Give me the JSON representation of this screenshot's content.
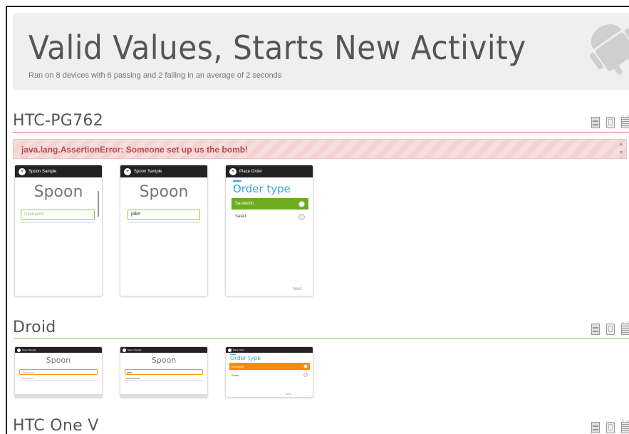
{
  "test": {
    "title": "Valid Values, Starts New Activity",
    "subtitle": "Ran on 8 devices with 6 passing and 2 failing in an average of 2 seconds"
  },
  "colors": {
    "fail_rule": "#e08080",
    "pass_rule": "#88cc66",
    "error_text": "#b94a48",
    "sandwich_green": "#6cac1e",
    "sandwich_orange": "#ff8a00",
    "order_blue": "#33a9d6"
  },
  "device_actions": {
    "icons": [
      "film-icon",
      "phone-icon",
      "log-icon"
    ]
  },
  "devices": [
    {
      "name": "HTC-PG762",
      "status": "failing",
      "error": "java.lang.AssertionError: Someone set up us the bomb!",
      "screens": [
        {
          "app_title": "Spoon Sample",
          "heading": "Spoon",
          "field_placeholder": "Username",
          "field_value": ""
        },
        {
          "app_title": "Spoon Sample",
          "heading": "Spoon",
          "field_placeholder": "",
          "field_value": "jake"
        },
        {
          "app_title": "Place Order",
          "heading": "Order type",
          "options": [
            "Sandwich",
            "Salad"
          ],
          "next": "Next"
        }
      ]
    },
    {
      "name": "Droid",
      "status": "passing",
      "screens": [
        {
          "app_title": "Spoon Sample",
          "heading": "Spoon",
          "field_placeholder": "Username",
          "password_placeholder": "Password"
        },
        {
          "app_title": "Spoon Sample",
          "heading": "Spoon",
          "field_value": "jake",
          "password_value": "••••••••••••••"
        },
        {
          "app_title": "Place Order",
          "heading": "Order type",
          "options": [
            "Sandwich",
            "Salad"
          ],
          "next": "Next"
        }
      ]
    },
    {
      "name": "HTC One V",
      "status": "unknown"
    }
  ]
}
